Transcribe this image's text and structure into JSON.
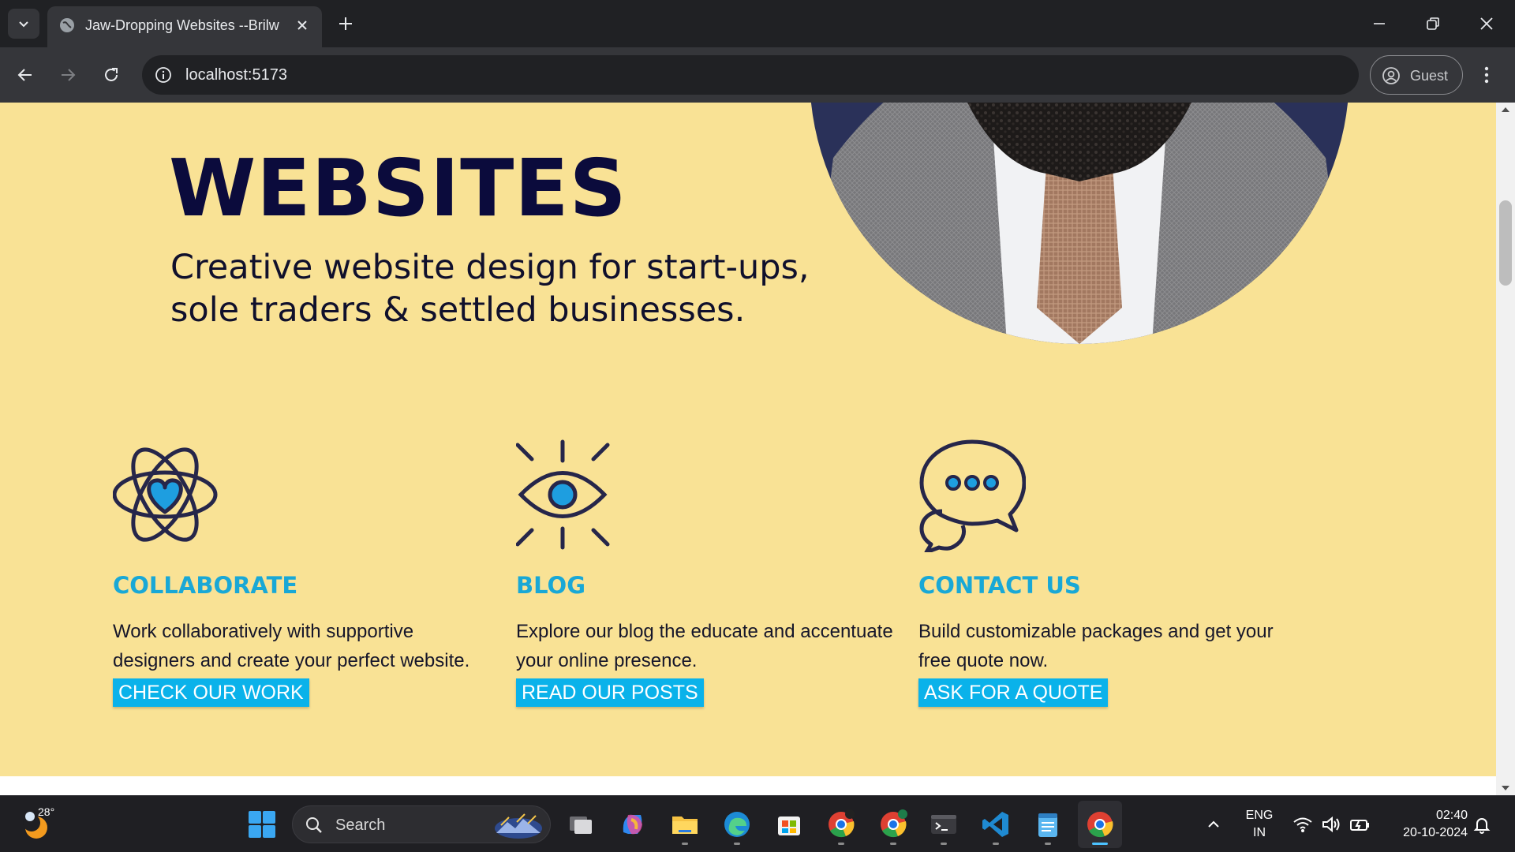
{
  "browser": {
    "tab_title": "Jaw-Dropping Websites --Brilw",
    "url": "localhost:5173",
    "profile_label": "Guest"
  },
  "hero": {
    "heading": "WEBSITES",
    "subheading": "Creative website design for start-ups, sole traders & settled businesses."
  },
  "features": [
    {
      "icon": "atom-heart-icon",
      "title": "COLLABORATE",
      "text": "Work collaboratively with supportive designers and create your perfect website.",
      "button": "CHECK OUR WORK"
    },
    {
      "icon": "eye-icon",
      "title": "BLOG",
      "text": "Explore our blog the educate and accentuate your online presence.",
      "button": "READ OUR POSTS"
    },
    {
      "icon": "chat-bubbles-icon",
      "title": "CONTACT US",
      "text": "Build customizable packages and get your free quote now.",
      "button": "ASK FOR A QUOTE"
    }
  ],
  "colors": {
    "page_background": "#f9e295",
    "heading": "#0b0b3c",
    "accent_title": "#19a8d6",
    "button_background": "#0ab2ea",
    "icon_blue": "#1e9ee0"
  },
  "taskbar": {
    "temperature": "28°",
    "search_label": "Search",
    "language_line1": "ENG",
    "language_line2": "IN",
    "time": "02:40",
    "date": "20-10-2024"
  }
}
